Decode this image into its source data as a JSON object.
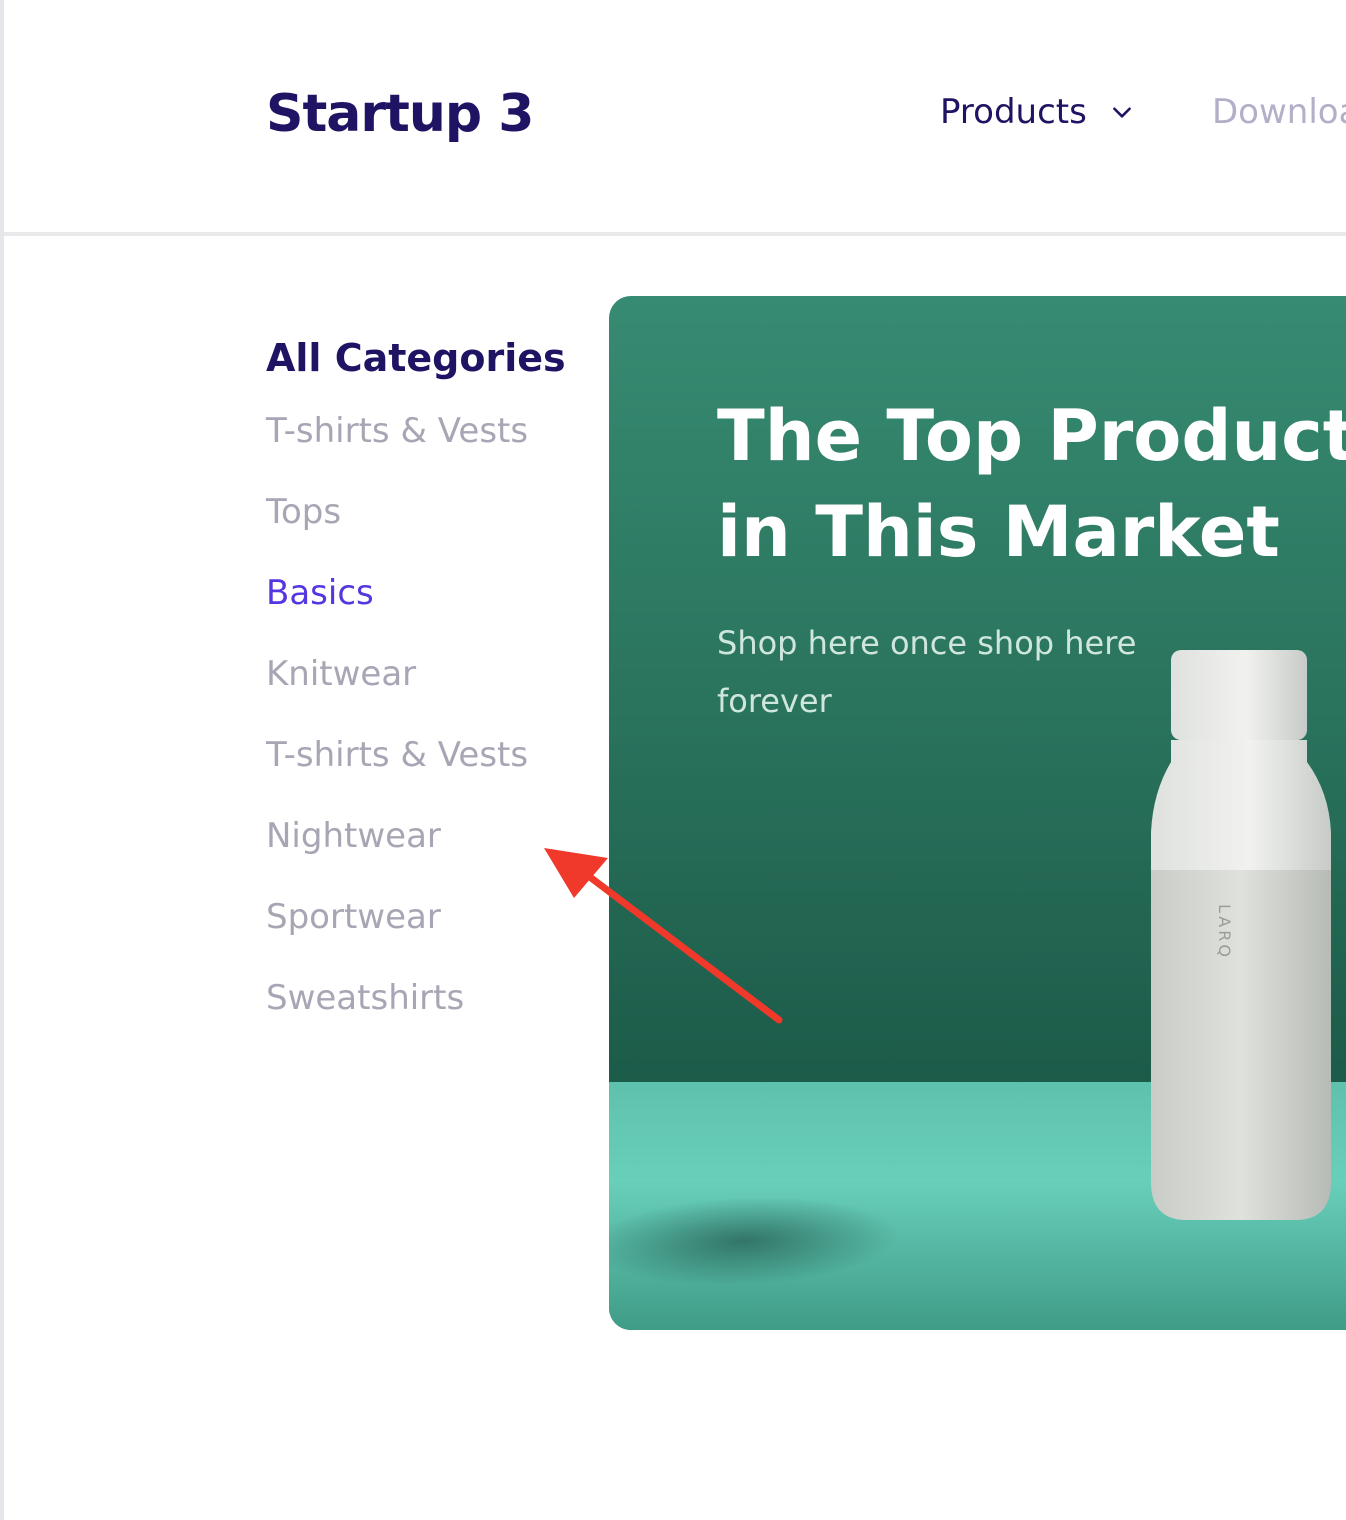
{
  "header": {
    "logo": "Startup 3",
    "nav": {
      "products_label": "Products",
      "download_label": "Downloa"
    }
  },
  "sidebar": {
    "title": "All Categories",
    "items": [
      {
        "label": "T-shirts & Vests",
        "active": false
      },
      {
        "label": "Tops",
        "active": false
      },
      {
        "label": "Basics",
        "active": true
      },
      {
        "label": "Knitwear",
        "active": false
      },
      {
        "label": "T-shirts & Vests",
        "active": false
      },
      {
        "label": "Nightwear",
        "active": false
      },
      {
        "label": "Sportwear",
        "active": false
      },
      {
        "label": "Sweatshirts",
        "active": false
      }
    ]
  },
  "hero": {
    "title_line1": "The Top Products",
    "title_line2": "in This Market",
    "subtitle": "Shop here once shop here forever",
    "bottle_brand": "LARQ"
  },
  "colors": {
    "brand": "#1f1463",
    "accent": "#5536e0",
    "muted": "#a8a6b4",
    "hero_green": "#2a735d",
    "annotation": "#f0392a"
  },
  "icons": {
    "products_dropdown": "chevron-down-icon",
    "annotation": "arrow-icon"
  }
}
